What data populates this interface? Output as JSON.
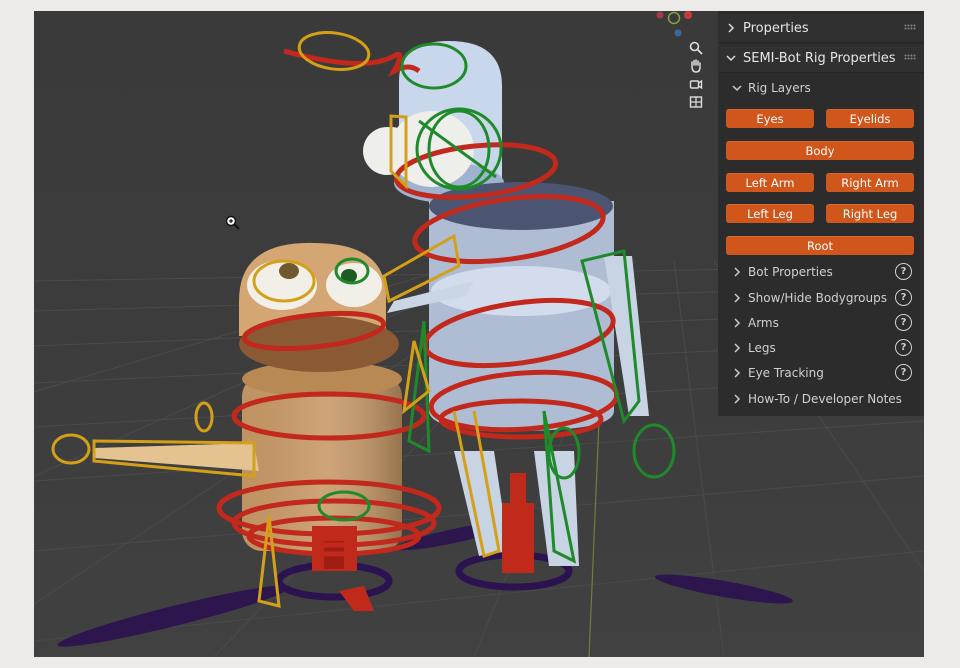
{
  "viewport": {
    "gizmo_icons": [
      "axis-gizmo-icon"
    ],
    "tools": [
      {
        "name": "zoom-icon",
        "glyph": "🔍"
      },
      {
        "name": "pan-hand-icon",
        "glyph": "✋"
      },
      {
        "name": "camera-view-icon",
        "glyph": "🎥"
      },
      {
        "name": "orthographic-grid-icon",
        "glyph": "▦"
      }
    ]
  },
  "panel": {
    "properties_title": "Properties",
    "rig_panel_title": "SEMI-Bot Rig Properties",
    "rig_layers_title": "Rig Layers",
    "buttons": {
      "eyes": "Eyes",
      "eyelids": "Eyelids",
      "body": "Body",
      "left_arm": "Left Arm",
      "right_arm": "Right Arm",
      "left_leg": "Left Leg",
      "right_leg": "Right Leg",
      "root": "Root"
    },
    "sections": [
      {
        "label": "Bot Properties",
        "help": "?"
      },
      {
        "label": "Show/Hide Bodygroups",
        "help": "?"
      },
      {
        "label": "Arms",
        "help": "?"
      },
      {
        "label": "Legs",
        "help": "?"
      },
      {
        "label": "Eye Tracking",
        "help": "?"
      },
      {
        "label": "How-To / Developer Notes",
        "help": ""
      }
    ]
  },
  "colors": {
    "button_orange": "#d0561b",
    "rig_red": "#c2281c",
    "rig_green": "#1f8a2a",
    "rig_yellow": "#d4a017"
  }
}
